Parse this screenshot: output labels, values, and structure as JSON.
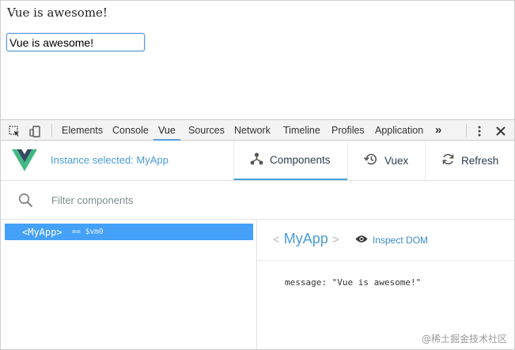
{
  "page": {
    "message_text": "Vue is awesome!",
    "input_value": "Vue is awesome!"
  },
  "devtools": {
    "tabs": [
      "Elements",
      "Console",
      "Vue",
      "Sources",
      "Network",
      "Timeline",
      "Profiles",
      "Application"
    ],
    "active_tab": "Vue",
    "more_label": "»"
  },
  "vue": {
    "instance_selected": "Instance selected: MyApp",
    "buttons": {
      "components": "Components",
      "vuex": "Vuex",
      "refresh": "Refresh"
    },
    "filter_placeholder": "Filter components",
    "tree": {
      "component_label": "<MyApp>",
      "vm_ref": "== $vm0"
    },
    "detail": {
      "open_bracket": "<",
      "name": "MyApp",
      "close_bracket": ">",
      "inspect_label": "Inspect DOM",
      "data_line": "message: \"Vue is awesome!\""
    }
  },
  "colors": {
    "accent": "#44a1f7",
    "link": "#4a9bd8",
    "vue_green": "#42b883",
    "vue_dark": "#35495e"
  },
  "watermark": "@稀土掘金技术社区"
}
